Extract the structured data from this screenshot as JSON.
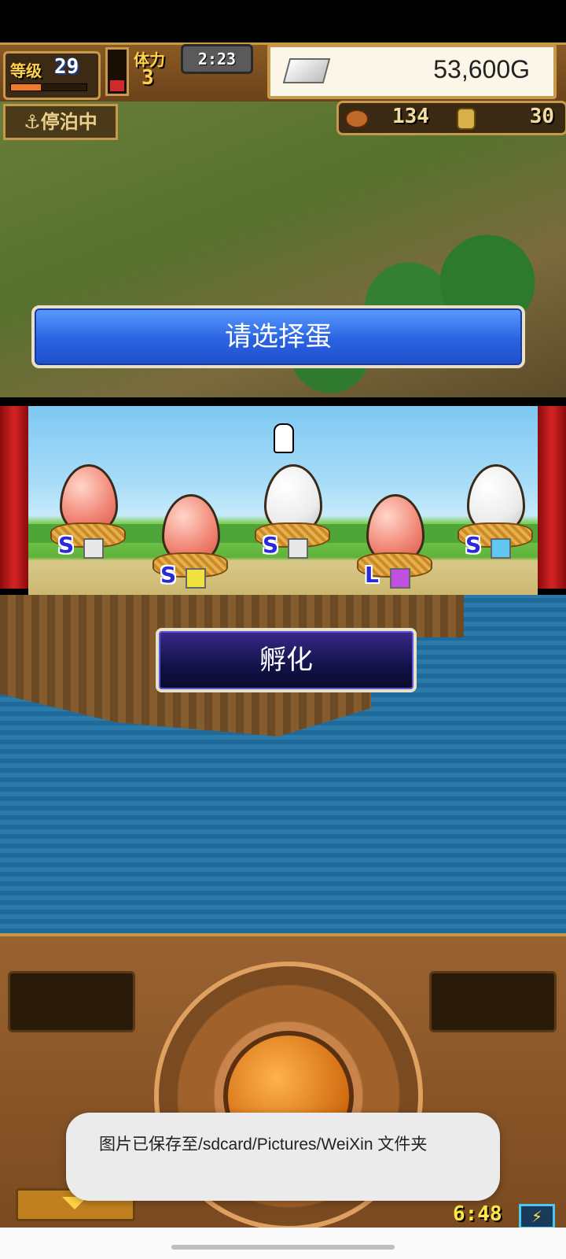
{
  "hud": {
    "level_label": "等级",
    "level_value": "29",
    "xp_fraction": 0.4,
    "stamina_label": "体力",
    "stamina_value": "3",
    "stamina_fraction": 0.35,
    "timer": "2:23",
    "gold": "53,600G"
  },
  "status": {
    "docked_badge": "⚓停泊中",
    "food_count": "134",
    "coin_count": "30"
  },
  "prompt": {
    "title": "请选择蛋"
  },
  "eggs": [
    {
      "color": "pink",
      "rank": "S",
      "element": "white-crystal-icon",
      "element_color": "#e8e8e8"
    },
    {
      "color": "pink",
      "rank": "S",
      "element": "lightning-icon",
      "element_color": "#f0e040"
    },
    {
      "color": "white",
      "rank": "S",
      "element": "white-crystal-icon",
      "element_color": "#e8e8e8"
    },
    {
      "color": "pink",
      "rank": "L",
      "element": "purple-gem-icon",
      "element_color": "#c050e0"
    },
    {
      "color": "white",
      "rank": "S",
      "element": "ice-icon",
      "element_color": "#60c8f0"
    }
  ],
  "actions": {
    "hatch_label": "孵化"
  },
  "footer": {
    "game_clock": "6:48"
  },
  "toast": {
    "message": "图片已保存至/sdcard/Pictures/WeiXin 文件夹"
  }
}
